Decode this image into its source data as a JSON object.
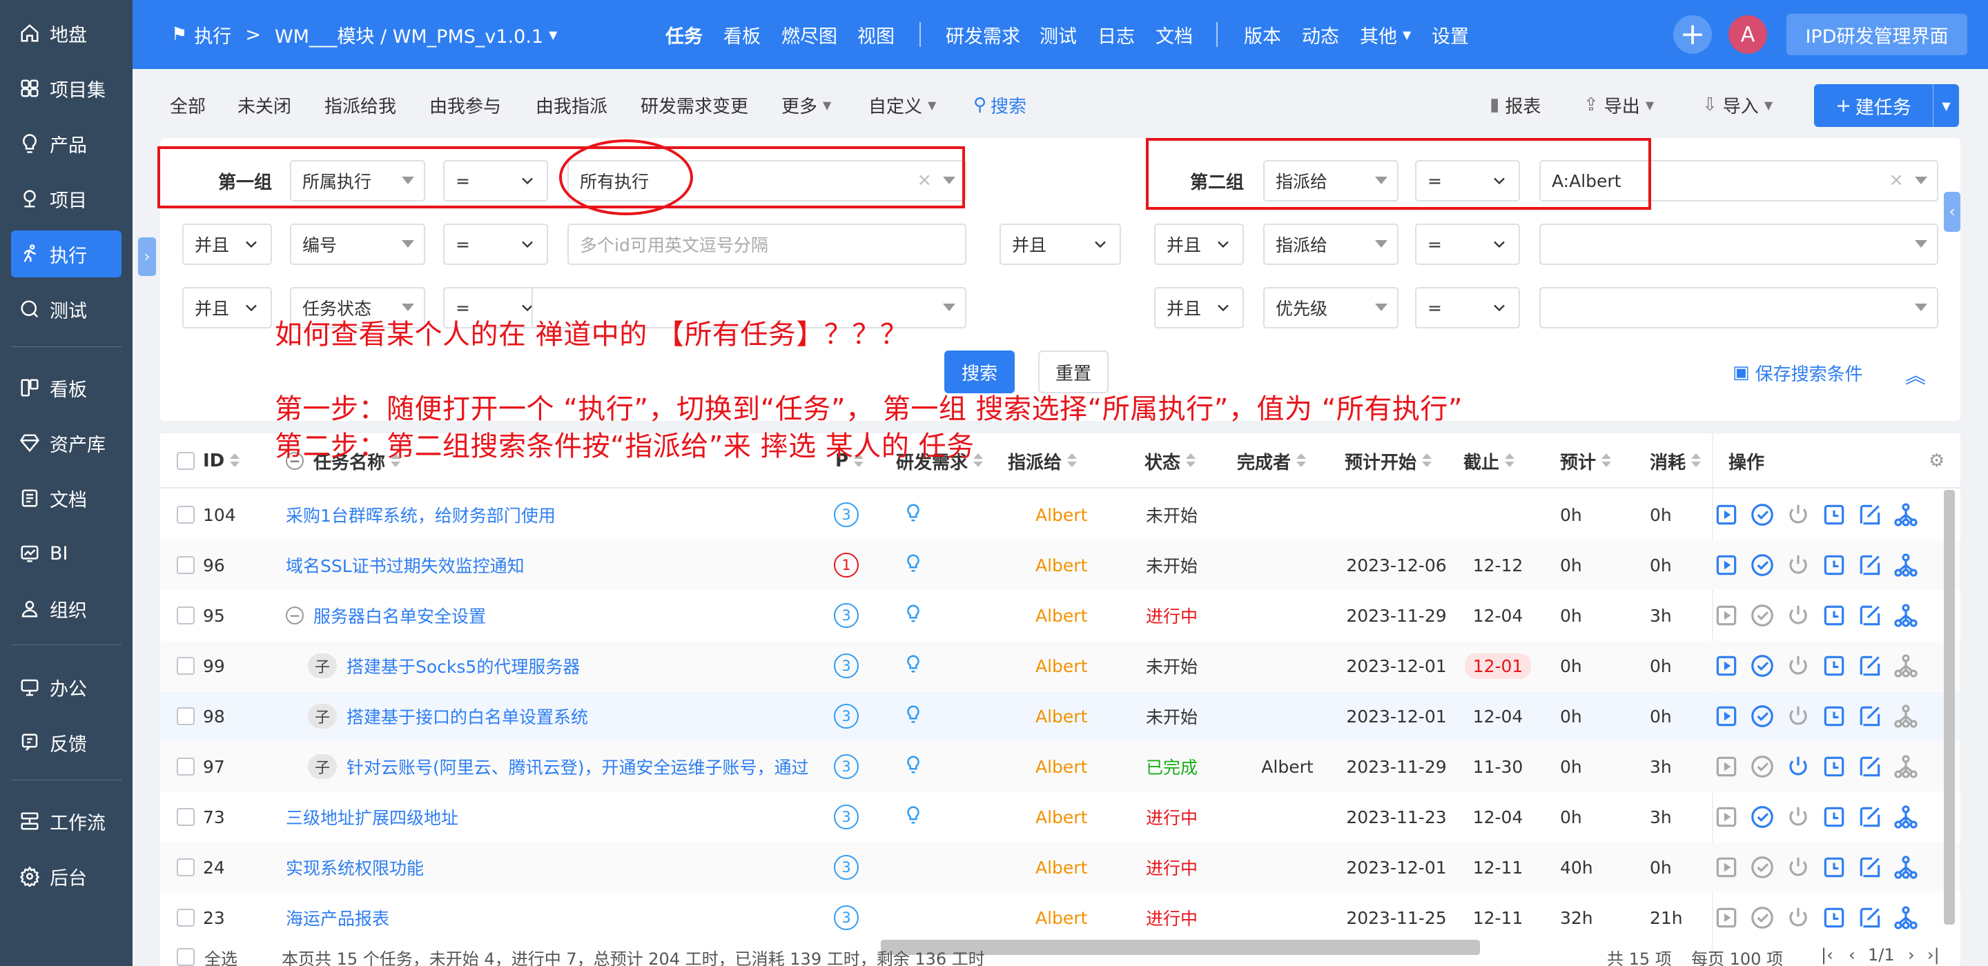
{
  "sidebar": {
    "items": [
      {
        "label": "地盘",
        "icon": "home-icon"
      },
      {
        "label": "项目集",
        "icon": "grid-icon"
      },
      {
        "label": "产品",
        "icon": "lightbulb-icon"
      },
      {
        "label": "项目",
        "icon": "project-icon"
      },
      {
        "label": "执行",
        "icon": "run-icon"
      },
      {
        "label": "测试",
        "icon": "search-icon"
      },
      {
        "label": "看板",
        "icon": "board-icon"
      },
      {
        "label": "资产库",
        "icon": "diamond-icon"
      },
      {
        "label": "文档",
        "icon": "document-icon"
      },
      {
        "label": "BI",
        "icon": "chart-icon"
      },
      {
        "label": "组织",
        "icon": "user-icon"
      },
      {
        "label": "办公",
        "icon": "monitor-icon"
      },
      {
        "label": "反馈",
        "icon": "feedback-icon"
      },
      {
        "label": "工作流",
        "icon": "workflow-icon"
      },
      {
        "label": "后台",
        "icon": "gear-icon"
      }
    ],
    "active_index": 4
  },
  "topbar": {
    "breadcrumb_root": "执行",
    "breadcrumb_sep": ">",
    "project": "WM___模块 / WM_PMS_v1.0.1",
    "nav1": [
      "任务",
      "看板",
      "燃尽图",
      "视图"
    ],
    "nav2": [
      "研发需求",
      "测试",
      "日志",
      "文档"
    ],
    "nav3": [
      "版本",
      "动态",
      "其他",
      "设置"
    ],
    "avatar": "A",
    "ipd": "IPD研发管理界面"
  },
  "subbar": {
    "filters": [
      "全部",
      "未关闭",
      "指派给我",
      "由我参与",
      "由我指派",
      "研发需求变更",
      "更多",
      "自定义"
    ],
    "search": "搜索",
    "report": "报表",
    "export": "导出",
    "import": "导入",
    "new_task": "建任务"
  },
  "search": {
    "group1": "第一组",
    "group2": "第二组",
    "g1": [
      {
        "logic": "",
        "field": "所属执行",
        "op": "=",
        "value": "所有执行"
      },
      {
        "logic": "并且",
        "field": "编号",
        "op": "=",
        "value": "",
        "placeholder": "多个id可用英文逗号分隔"
      },
      {
        "logic": "并且",
        "field": "任务状态",
        "op": "=",
        "value": ""
      }
    ],
    "g2": [
      {
        "logic": "",
        "field": "指派给",
        "op": "=",
        "value": "A:Albert"
      },
      {
        "logic": "并且",
        "field": "指派给",
        "op": "=",
        "value": ""
      },
      {
        "logic": "并且",
        "field": "优先级",
        "op": "=",
        "value": ""
      }
    ],
    "group_logic": "并且",
    "search_btn": "搜索",
    "reset_btn": "重置",
    "save_cond": "保存搜索条件"
  },
  "annotation": {
    "line1": "如何查看某个人的在 禅道中的 【所有任务】？？？",
    "line2": "第一步：随便打开一个 “执行”，切换到“任务”， 第一组 搜索选择“所属执行”，值为 “所有执行”",
    "line3": "第二步：第二组搜索条件按“指派给”来 摔选 某人的 任务"
  },
  "table": {
    "headers": {
      "id": "ID",
      "name": "任务名称",
      "pri": "P",
      "story": "研发需求",
      "assigned": "指派给",
      "status": "状态",
      "finished_by": "完成者",
      "est_start": "预计开始",
      "deadline": "截止",
      "estimate": "预计",
      "consumed": "消耗",
      "actions": "操作"
    },
    "rows": [
      {
        "id": "104",
        "name": "采购1台群晖系统，给财务部门使用",
        "pri": "3",
        "story": true,
        "assigned": "Albert",
        "status": "未开始",
        "finished_by": "",
        "est_start": "",
        "deadline": "",
        "estimate": "0h",
        "consumed": "0h"
      },
      {
        "id": "96",
        "name": "域名SSL证书过期失效监控通知",
        "pri": "1",
        "story": true,
        "assigned": "Albert",
        "status": "未开始",
        "finished_by": "",
        "est_start": "2023-12-06",
        "deadline": "12-12",
        "estimate": "0h",
        "consumed": "0h"
      },
      {
        "id": "95",
        "name": "服务器白名单安全设置",
        "pri": "3",
        "story": true,
        "assigned": "Albert",
        "status": "进行中",
        "finished_by": "",
        "est_start": "2023-11-29",
        "deadline": "12-04",
        "estimate": "0h",
        "consumed": "3h"
      },
      {
        "id": "99",
        "name": "搭建基于Socks5的代理服务器",
        "pri": "3",
        "story": true,
        "assigned": "Albert",
        "status": "未开始",
        "finished_by": "",
        "est_start": "2023-12-01",
        "deadline": "12-01",
        "estimate": "0h",
        "consumed": "0h"
      },
      {
        "id": "98",
        "name": "搭建基于接口的白名单设置系统",
        "pri": "3",
        "story": true,
        "assigned": "Albert",
        "status": "未开始",
        "finished_by": "",
        "est_start": "2023-12-01",
        "deadline": "12-04",
        "estimate": "0h",
        "consumed": "0h"
      },
      {
        "id": "97",
        "name": "针对云账号(阿里云、腾讯云登)，开通安全运维子账号，通过",
        "pri": "3",
        "story": true,
        "assigned": "Albert",
        "status": "已完成",
        "finished_by": "Albert",
        "est_start": "2023-11-29",
        "deadline": "11-30",
        "estimate": "0h",
        "consumed": "3h"
      },
      {
        "id": "73",
        "name": "三级地址扩展四级地址",
        "pri": "3",
        "story": true,
        "assigned": "Albert",
        "status": "进行中",
        "finished_by": "",
        "est_start": "2023-11-23",
        "deadline": "12-04",
        "estimate": "0h",
        "consumed": "3h"
      },
      {
        "id": "24",
        "name": "实现系统权限功能",
        "pri": "3",
        "story": false,
        "assigned": "Albert",
        "status": "进行中",
        "finished_by": "",
        "est_start": "2023-12-01",
        "deadline": "12-11",
        "estimate": "40h",
        "consumed": "0h"
      },
      {
        "id": "23",
        "name": "海运产品报表",
        "pri": "3",
        "story": false,
        "assigned": "Albert",
        "status": "进行中",
        "finished_by": "",
        "est_start": "2023-11-25",
        "deadline": "12-11",
        "estimate": "32h",
        "consumed": "21h"
      }
    ],
    "child_tag": "子"
  },
  "footer": {
    "select_all": "全选",
    "summary": "本页共 15 个任务，未开始 4，进行中 7，总预计 204 工时，已消耗 139 工时，剩余 136 工时",
    "total": "共 15 项",
    "per_page": "每页 100 项",
    "page": "1/1"
  },
  "colors": {
    "primary": "#2e7ef2",
    "sidebar": "#34495e",
    "annotation": "#e8141a",
    "assignee": "#f39200",
    "done": "#1aad19"
  }
}
